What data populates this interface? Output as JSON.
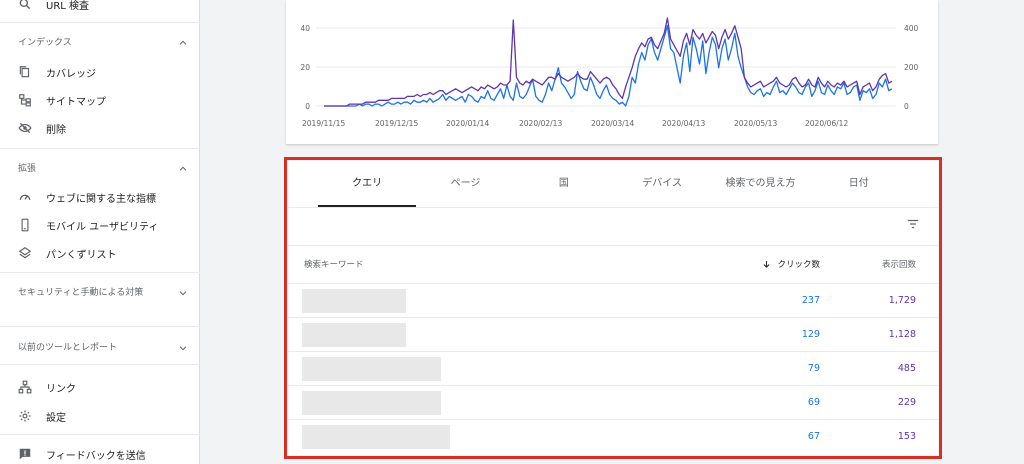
{
  "sidebar": {
    "url_inspection": "URL 検査",
    "index_header": "インデックス",
    "coverage": "カバレッジ",
    "sitemaps": "サイトマップ",
    "removals": "削除",
    "enhancements_header": "拡張",
    "core_web_vitals": "ウェブに関する主な指標",
    "mobile_usability": "モバイル ユーザビリティ",
    "breadcrumbs": "パンくずリスト",
    "security_header": "セキュリティと手動による対策",
    "legacy_header": "以前のツールとレポート",
    "links": "リンク",
    "settings": "設定",
    "feedback": "フィードバックを送信"
  },
  "chart_data": {
    "type": "line",
    "x_ticks": [
      "2019/11/15",
      "2019/12/15",
      "2020/01/14",
      "2020/02/13",
      "2020/03/14",
      "2020/04/13",
      "2020/05/13",
      "2020/06/12"
    ],
    "left_axis_ticks": [
      "0",
      "20",
      "40"
    ],
    "right_axis_ticks": [
      "0",
      "200",
      "400"
    ],
    "ylim_left": [
      0,
      45
    ],
    "ylim_right": [
      0,
      450
    ],
    "series": [
      {
        "color": "#1a73e8",
        "axis": "left",
        "values": [
          0,
          0,
          0,
          0,
          0,
          0,
          0,
          0,
          0,
          0,
          0,
          1,
          0,
          1,
          1,
          0,
          1,
          1,
          0,
          1,
          2,
          1,
          1,
          2,
          1,
          2,
          2,
          1,
          3,
          2,
          2,
          3,
          2,
          4,
          2,
          3,
          4,
          6,
          3,
          5,
          4,
          3,
          4,
          5,
          2,
          6,
          5,
          3,
          2,
          5,
          4,
          8,
          4,
          3,
          6,
          9,
          4,
          11,
          5,
          3,
          12,
          5,
          4,
          6,
          10,
          14,
          5,
          3,
          2,
          6,
          12,
          8,
          14,
          20,
          12,
          10,
          7,
          4,
          6,
          18,
          13,
          9,
          8,
          15,
          11,
          6,
          4,
          8,
          11,
          6,
          4,
          3,
          1,
          2,
          0,
          5,
          15,
          12,
          22,
          28,
          24,
          32,
          35,
          28,
          24,
          30,
          36,
          42,
          30,
          28,
          20,
          12,
          26,
          33,
          18,
          36,
          30,
          22,
          34,
          17,
          28,
          36,
          32,
          20,
          30,
          35,
          24,
          30,
          38,
          26,
          20,
          15,
          10,
          7,
          6,
          8,
          9,
          5,
          7,
          6,
          10,
          13,
          7,
          8,
          6,
          9,
          12,
          10,
          7,
          6,
          10,
          12,
          5,
          8,
          13,
          7,
          6,
          11,
          8,
          6,
          10,
          9,
          12,
          6,
          7,
          10,
          11,
          3,
          8,
          7,
          9,
          4,
          6,
          12,
          10,
          14,
          8,
          9
        ]
      },
      {
        "color": "#5e35b1",
        "axis": "right",
        "values": [
          0,
          0,
          0,
          0,
          0,
          0,
          0,
          0,
          10,
          10,
          10,
          10,
          10,
          20,
          20,
          20,
          20,
          30,
          30,
          30,
          30,
          40,
          40,
          40,
          40,
          40,
          50,
          50,
          50,
          60,
          50,
          60,
          60,
          70,
          60,
          70,
          80,
          80,
          60,
          70,
          80,
          90,
          80,
          70,
          80,
          90,
          100,
          90,
          80,
          100,
          90,
          110,
          100,
          90,
          100,
          120,
          110,
          110,
          130,
          450,
          150,
          120,
          110,
          130,
          120,
          140,
          130,
          120,
          110,
          130,
          150,
          150,
          140,
          170,
          150,
          140,
          130,
          140,
          150,
          170,
          150,
          140,
          140,
          180,
          160,
          140,
          120,
          140,
          150,
          140,
          110,
          90,
          60,
          40,
          100,
          150,
          200,
          260,
          300,
          330,
          310,
          350,
          360,
          320,
          300,
          340,
          380,
          460,
          350,
          320,
          290,
          260,
          340,
          380,
          320,
          400,
          370,
          350,
          380,
          330,
          360,
          390,
          370,
          300,
          360,
          400,
          350,
          380,
          420,
          360,
          300,
          150,
          120,
          100,
          110,
          120,
          130,
          100,
          110,
          120,
          130,
          150,
          120,
          110,
          100,
          110,
          140,
          150,
          120,
          100,
          110,
          140,
          110,
          100,
          150,
          120,
          100,
          130,
          110,
          100,
          120,
          110,
          130,
          100,
          110,
          120,
          130,
          60,
          100,
          110,
          120,
          80,
          100,
          140,
          160,
          170,
          120,
          130
        ]
      }
    ]
  },
  "table": {
    "tabs": [
      "クエリ",
      "ページ",
      "国",
      "デバイス",
      "検索での見え方",
      "日付"
    ],
    "headers": {
      "keyword": "検索キーワード",
      "clicks": "クリック数",
      "impressions": "表示回数"
    },
    "rows": [
      {
        "clicks": "237",
        "impressions": "1,729"
      },
      {
        "clicks": "129",
        "impressions": "1,128"
      },
      {
        "clicks": "79",
        "impressions": "485"
      },
      {
        "clicks": "69",
        "impressions": "229"
      },
      {
        "clicks": "67",
        "impressions": "153"
      }
    ]
  },
  "colors": {
    "clicks": "#1a73e8",
    "impressions": "#5e35b1",
    "highlight": "#d93025"
  }
}
